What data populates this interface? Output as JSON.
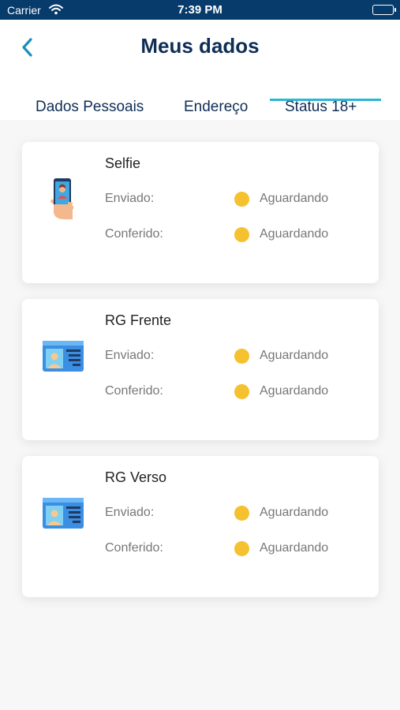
{
  "status_bar": {
    "carrier": "Carrier",
    "time": "7:39 PM"
  },
  "header": {
    "title": "Meus dados"
  },
  "tabs": [
    {
      "label": "Dados Pessoais"
    },
    {
      "label": "Endereço"
    },
    {
      "label": "Status 18+",
      "active": true
    }
  ],
  "colors": {
    "primary": "#0f2e55",
    "accent": "#2bb5d8",
    "status_pending": "#f5c12e"
  },
  "cards": [
    {
      "title": "Selfie",
      "icon": "selfie-phone-icon",
      "sent_label": "Enviado:",
      "sent_status": "Aguardando",
      "checked_label": "Conferido:",
      "checked_status": "Aguardando"
    },
    {
      "title": "RG Frente",
      "icon": "id-card-front-icon",
      "sent_label": "Enviado:",
      "sent_status": "Aguardando",
      "checked_label": "Conferido:",
      "checked_status": "Aguardando"
    },
    {
      "title": "RG Verso",
      "icon": "id-card-back-icon",
      "sent_label": "Enviado:",
      "sent_status": "Aguardando",
      "checked_label": "Conferido:",
      "checked_status": "Aguardando"
    }
  ]
}
